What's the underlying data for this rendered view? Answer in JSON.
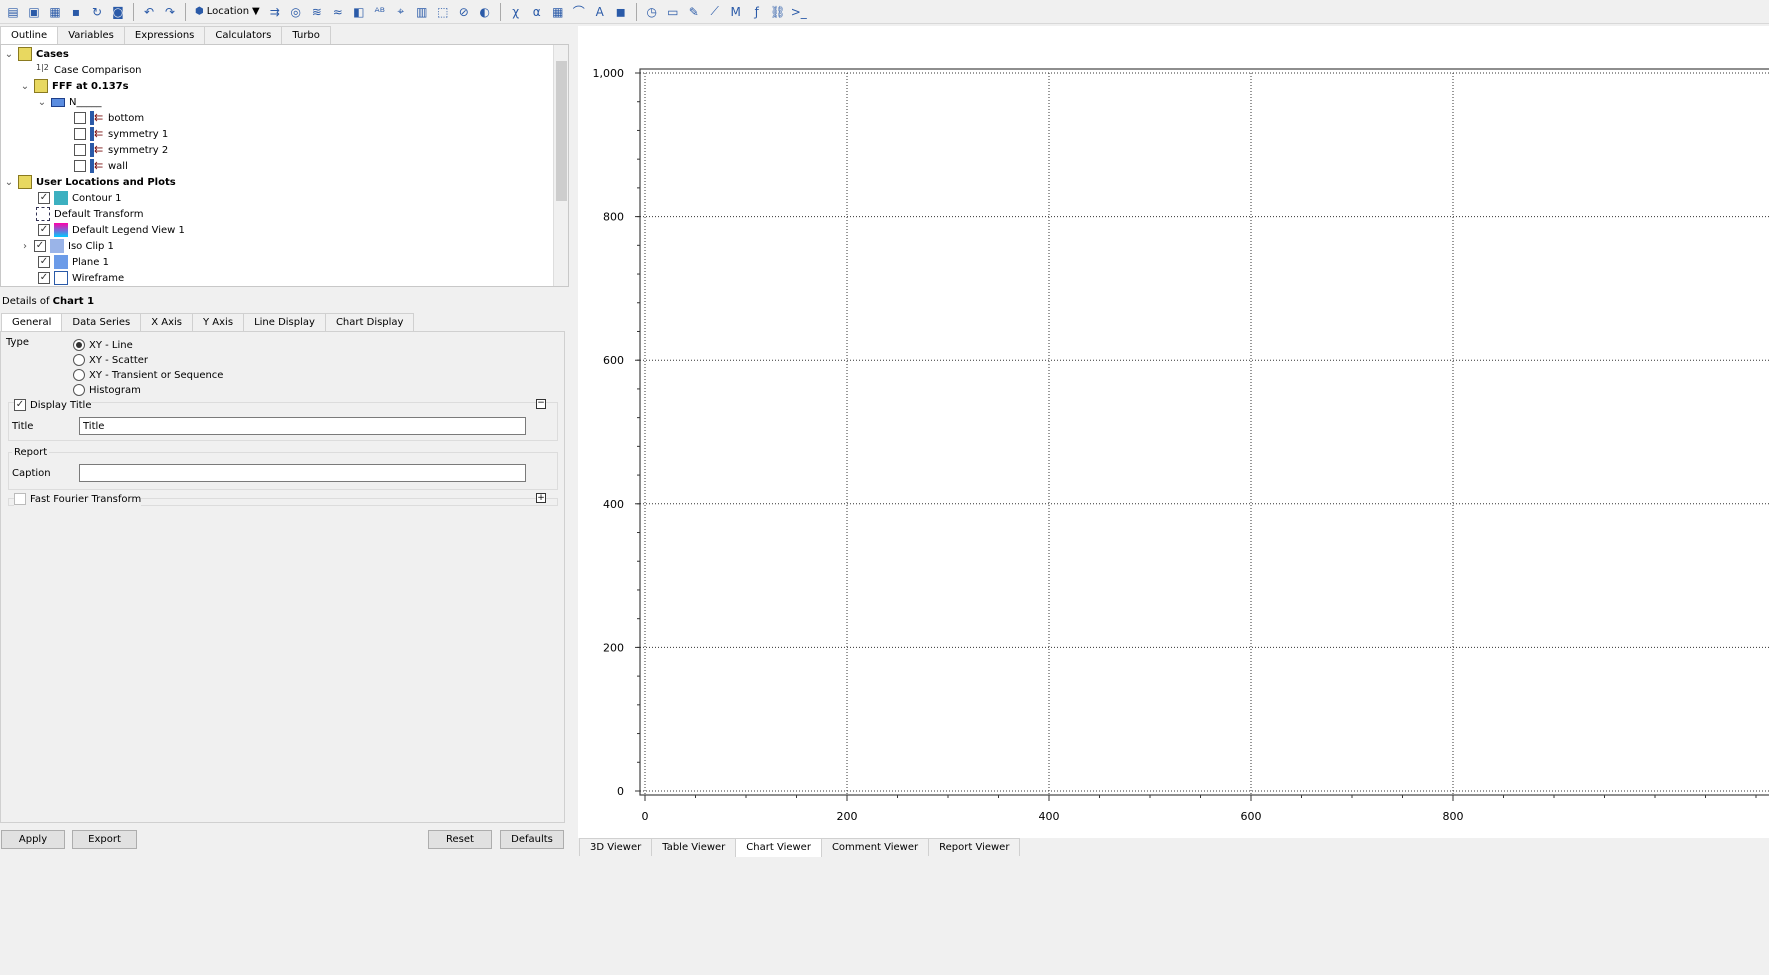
{
  "toolbar": {
    "location_label": "Location",
    "icons": [
      "new-file",
      "open-file",
      "open-results",
      "save",
      "refresh",
      "screenshot",
      "undo",
      "redo",
      "location",
      "streamline",
      "contour",
      "vector",
      "isosurface",
      "volume",
      "text",
      "coordinate-frame",
      "legend",
      "transform",
      "clip-plane",
      "color-map",
      "variable",
      "expression",
      "table",
      "chart",
      "comment",
      "figure",
      "clock",
      "animation",
      "quick-editor",
      "probe",
      "macro",
      "function-calculator",
      "mesh",
      "command-line"
    ]
  },
  "left_tabs": [
    "Outline",
    "Variables",
    "Expressions",
    "Calculators",
    "Turbo"
  ],
  "tree": {
    "cases": "Cases",
    "case_comparison": "Case Comparison",
    "fff": "FFF at 0.137s",
    "domain": "N_____",
    "boundaries": [
      "bottom",
      "symmetry 1",
      "symmetry 2",
      "wall"
    ],
    "user_locations": "User Locations and Plots",
    "items": [
      {
        "label": "Contour 1",
        "checked": true
      },
      {
        "label": "Default Transform"
      },
      {
        "label": "Default Legend View 1",
        "checked": true
      },
      {
        "label": "Iso Clip 1",
        "checked": true
      },
      {
        "label": "Plane 1",
        "checked": true
      },
      {
        "label": "Wireframe",
        "checked": true
      }
    ]
  },
  "details": {
    "prefix": "Details of ",
    "object": "Chart 1",
    "tabs": [
      "General",
      "Data Series",
      "X Axis",
      "Y Axis",
      "Line Display",
      "Chart Display"
    ],
    "type_label": "Type",
    "types": [
      "XY - Line",
      "XY - Scatter",
      "XY - Transient or Sequence",
      "Histogram"
    ],
    "selected_type": "XY - Line",
    "display_title_label": "Display Title",
    "display_title": true,
    "title_label": "Title",
    "title_value": "Title",
    "report_label": "Report",
    "caption_label": "Caption",
    "caption_value": "",
    "fft_label": "Fast Fourier Transform",
    "fft": false,
    "buttons": {
      "apply": "Apply",
      "export": "Export",
      "reset": "Reset",
      "defaults": "Defaults"
    }
  },
  "viewer_tabs": [
    "3D Viewer",
    "Table Viewer",
    "Chart Viewer",
    "Comment Viewer",
    "Report Viewer"
  ],
  "active_viewer": "Chart Viewer",
  "chart_data": {
    "type": "line",
    "title": "",
    "xlabel": "",
    "ylabel": "",
    "xlim": [
      0,
      1000
    ],
    "ylim": [
      0,
      1000
    ],
    "grid": true,
    "x_ticks": [
      "0",
      "200",
      "400",
      "600",
      "800"
    ],
    "y_ticks": [
      "0",
      "200",
      "400",
      "600",
      "800",
      "1,000"
    ],
    "series": []
  }
}
